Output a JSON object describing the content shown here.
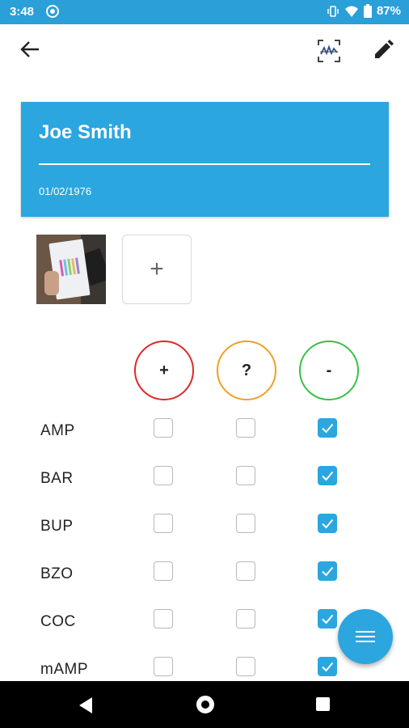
{
  "status_bar": {
    "time": "3:48",
    "battery": "87%",
    "icons": [
      "sync-icon",
      "vibrate-icon",
      "wifi-icon",
      "battery-icon"
    ]
  },
  "app_bar": {
    "icons": [
      "back-arrow-icon",
      "scan-signature-icon",
      "edit-pencil-icon"
    ]
  },
  "patient": {
    "name": "Joe Smith",
    "dob": "01/02/1976"
  },
  "photos": {
    "add_label": "+"
  },
  "results_header": {
    "positive": "+",
    "unknown": "?",
    "negative": "-",
    "colors": {
      "positive": "#e02828",
      "unknown": "#f0a023",
      "negative": "#35c245"
    }
  },
  "tests": [
    {
      "name": "AMP",
      "positive": false,
      "unknown": false,
      "negative": true
    },
    {
      "name": "BAR",
      "positive": false,
      "unknown": false,
      "negative": true
    },
    {
      "name": "BUP",
      "positive": false,
      "unknown": false,
      "negative": true
    },
    {
      "name": "BZO",
      "positive": false,
      "unknown": false,
      "negative": true
    },
    {
      "name": "COC",
      "positive": false,
      "unknown": false,
      "negative": true
    },
    {
      "name": "mAMP",
      "positive": false,
      "unknown": false,
      "negative": true
    }
  ],
  "accent_color": "#2ba6df",
  "fab": {
    "icon": "menu-lines-icon"
  },
  "nav_bar": {
    "icons": [
      "nav-back-icon",
      "nav-home-icon",
      "nav-recents-icon"
    ]
  }
}
